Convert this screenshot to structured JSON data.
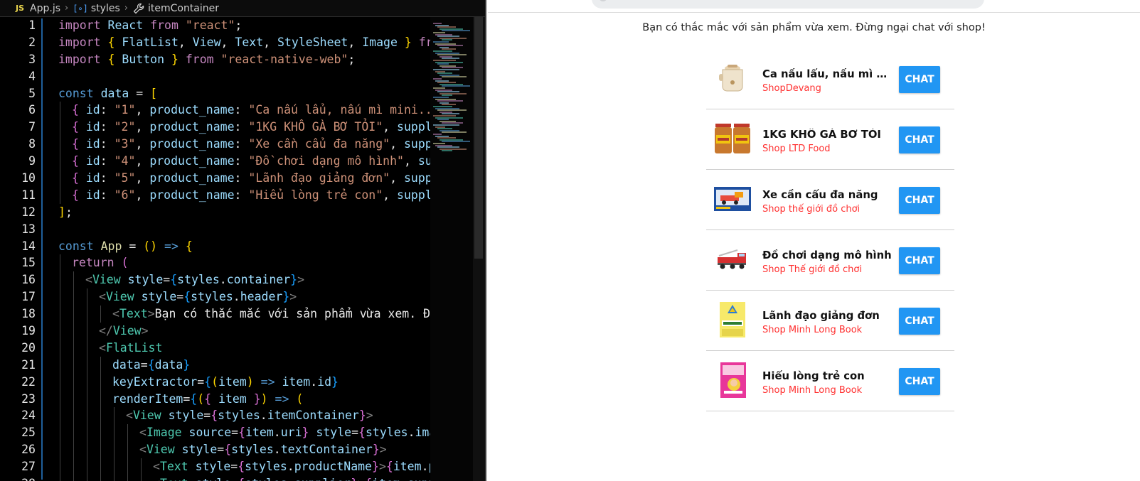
{
  "breadcrumb": {
    "badge": "JS",
    "file": "App.js",
    "crumb_2": "styles",
    "crumb_3": "itemContainer"
  },
  "editor": {
    "lines": [
      {
        "n": "1",
        "indent": 0,
        "tokens": [
          [
            "k-imp",
            "import"
          ],
          [
            "txt",
            " "
          ],
          [
            "ident",
            "React"
          ],
          [
            "txt",
            " "
          ],
          [
            "k-imp",
            "from"
          ],
          [
            "txt",
            " "
          ],
          [
            "str",
            "\"react\""
          ],
          [
            "txt",
            ";"
          ]
        ]
      },
      {
        "n": "2",
        "indent": 0,
        "tokens": [
          [
            "k-imp",
            "import"
          ],
          [
            "txt",
            " "
          ],
          [
            "brace",
            "{"
          ],
          [
            "txt",
            " "
          ],
          [
            "ident",
            "FlatList"
          ],
          [
            "txt",
            ", "
          ],
          [
            "ident",
            "View"
          ],
          [
            "txt",
            ", "
          ],
          [
            "ident",
            "Text"
          ],
          [
            "txt",
            ", "
          ],
          [
            "ident",
            "StyleSheet"
          ],
          [
            "txt",
            ", "
          ],
          [
            "ident",
            "Image"
          ],
          [
            "txt",
            " "
          ],
          [
            "brace",
            "}"
          ],
          [
            "txt",
            " "
          ],
          [
            "k-imp",
            "fro"
          ]
        ]
      },
      {
        "n": "3",
        "indent": 0,
        "tokens": [
          [
            "k-imp",
            "import"
          ],
          [
            "txt",
            " "
          ],
          [
            "brace",
            "{"
          ],
          [
            "txt",
            " "
          ],
          [
            "ident",
            "Button"
          ],
          [
            "txt",
            " "
          ],
          [
            "brace",
            "}"
          ],
          [
            "txt",
            " "
          ],
          [
            "k-imp",
            "from"
          ],
          [
            "txt",
            " "
          ],
          [
            "str",
            "\"react-native-web\""
          ],
          [
            "txt",
            ";"
          ]
        ]
      },
      {
        "n": "4",
        "indent": 0,
        "tokens": []
      },
      {
        "n": "5",
        "indent": 0,
        "tokens": [
          [
            "k-dec",
            "const"
          ],
          [
            "txt",
            " "
          ],
          [
            "ident",
            "data"
          ],
          [
            "txt",
            " = "
          ],
          [
            "brace",
            "["
          ]
        ]
      },
      {
        "n": "6",
        "indent": 1,
        "tokens": [
          [
            "brace2",
            "{"
          ],
          [
            "txt",
            " "
          ],
          [
            "ident",
            "id"
          ],
          [
            "txt",
            ": "
          ],
          [
            "str",
            "\"1\""
          ],
          [
            "txt",
            ", "
          ],
          [
            "ident",
            "product_name"
          ],
          [
            "txt",
            ": "
          ],
          [
            "str",
            "\"Ca nấu lẩu, nấu mì mini...\""
          ],
          [
            "txt",
            " "
          ]
        ]
      },
      {
        "n": "7",
        "indent": 1,
        "tokens": [
          [
            "brace2",
            "{"
          ],
          [
            "txt",
            " "
          ],
          [
            "ident",
            "id"
          ],
          [
            "txt",
            ": "
          ],
          [
            "str",
            "\"2\""
          ],
          [
            "txt",
            ", "
          ],
          [
            "ident",
            "product_name"
          ],
          [
            "txt",
            ": "
          ],
          [
            "str",
            "\"1KG KHÔ GÀ BƠ TỎI\""
          ],
          [
            "txt",
            ", "
          ],
          [
            "ident",
            "suppli"
          ]
        ]
      },
      {
        "n": "8",
        "indent": 1,
        "tokens": [
          [
            "brace2",
            "{"
          ],
          [
            "txt",
            " "
          ],
          [
            "ident",
            "id"
          ],
          [
            "txt",
            ": "
          ],
          [
            "str",
            "\"3\""
          ],
          [
            "txt",
            ", "
          ],
          [
            "ident",
            "product_name"
          ],
          [
            "txt",
            ": "
          ],
          [
            "str",
            "\"Xe cần cẩu đa năng\""
          ],
          [
            "txt",
            ", "
          ],
          [
            "ident",
            "suppl"
          ]
        ]
      },
      {
        "n": "9",
        "indent": 1,
        "tokens": [
          [
            "brace2",
            "{"
          ],
          [
            "txt",
            " "
          ],
          [
            "ident",
            "id"
          ],
          [
            "txt",
            ": "
          ],
          [
            "str",
            "\"4\""
          ],
          [
            "txt",
            ", "
          ],
          [
            "ident",
            "product_name"
          ],
          [
            "txt",
            ": "
          ],
          [
            "str",
            "\"Đồ chơi dạng mô hình\""
          ],
          [
            "txt",
            ", "
          ],
          [
            "ident",
            "sup"
          ]
        ]
      },
      {
        "n": "10",
        "indent": 1,
        "tokens": [
          [
            "brace2",
            "{"
          ],
          [
            "txt",
            " "
          ],
          [
            "ident",
            "id"
          ],
          [
            "txt",
            ": "
          ],
          [
            "str",
            "\"5\""
          ],
          [
            "txt",
            ", "
          ],
          [
            "ident",
            "product_name"
          ],
          [
            "txt",
            ": "
          ],
          [
            "str",
            "\"Lãnh đạo giảng đơn\""
          ],
          [
            "txt",
            ", "
          ],
          [
            "ident",
            "suppl"
          ]
        ]
      },
      {
        "n": "11",
        "indent": 1,
        "tokens": [
          [
            "brace2",
            "{"
          ],
          [
            "txt",
            " "
          ],
          [
            "ident",
            "id"
          ],
          [
            "txt",
            ": "
          ],
          [
            "str",
            "\"6\""
          ],
          [
            "txt",
            ", "
          ],
          [
            "ident",
            "product_name"
          ],
          [
            "txt",
            ": "
          ],
          [
            "str",
            "\"Hiểu lòng trẻ con\""
          ],
          [
            "txt",
            ", "
          ],
          [
            "ident",
            "suppli"
          ]
        ]
      },
      {
        "n": "12",
        "indent": 0,
        "tokens": [
          [
            "brace",
            "]"
          ],
          [
            "txt",
            ";"
          ]
        ]
      },
      {
        "n": "13",
        "indent": 0,
        "tokens": []
      },
      {
        "n": "14",
        "indent": 0,
        "tokens": [
          [
            "k-dec",
            "const"
          ],
          [
            "txt",
            " "
          ],
          [
            "fn",
            "App"
          ],
          [
            "txt",
            " = "
          ],
          [
            "brace",
            "()"
          ],
          [
            "txt",
            " "
          ],
          [
            "k-dec",
            "=>"
          ],
          [
            "txt",
            " "
          ],
          [
            "brace",
            "{"
          ]
        ]
      },
      {
        "n": "15",
        "indent": 1,
        "tokens": [
          [
            "k-imp",
            "return"
          ],
          [
            "txt",
            " "
          ],
          [
            "brace2",
            "("
          ]
        ]
      },
      {
        "n": "16",
        "indent": 2,
        "tokens": [
          [
            "punct",
            "<"
          ],
          [
            "tag",
            "View"
          ],
          [
            "txt",
            " "
          ],
          [
            "ident",
            "style"
          ],
          [
            "txt",
            "="
          ],
          [
            "brace3",
            "{"
          ],
          [
            "ident",
            "styles"
          ],
          [
            "txt",
            "."
          ],
          [
            "ident",
            "container"
          ],
          [
            "brace3",
            "}"
          ],
          [
            "punct",
            ">"
          ]
        ]
      },
      {
        "n": "17",
        "indent": 3,
        "tokens": [
          [
            "punct",
            "<"
          ],
          [
            "tag",
            "View"
          ],
          [
            "txt",
            " "
          ],
          [
            "ident",
            "style"
          ],
          [
            "txt",
            "="
          ],
          [
            "brace3",
            "{"
          ],
          [
            "ident",
            "styles"
          ],
          [
            "txt",
            "."
          ],
          [
            "ident",
            "header"
          ],
          [
            "brace3",
            "}"
          ],
          [
            "punct",
            ">"
          ]
        ]
      },
      {
        "n": "18",
        "indent": 4,
        "tokens": [
          [
            "punct",
            "<"
          ],
          [
            "tag",
            "Text"
          ],
          [
            "punct",
            ">"
          ],
          [
            "txt",
            "Bạn có thắc mắc với sản phẩm vừa xem. Đừ"
          ]
        ]
      },
      {
        "n": "19",
        "indent": 3,
        "tokens": [
          [
            "punct",
            "</"
          ],
          [
            "tag",
            "View"
          ],
          [
            "punct",
            ">"
          ]
        ]
      },
      {
        "n": "20",
        "indent": 3,
        "tokens": [
          [
            "punct",
            "<"
          ],
          [
            "tag",
            "FlatList"
          ]
        ]
      },
      {
        "n": "21",
        "indent": 4,
        "tokens": [
          [
            "ident",
            "data"
          ],
          [
            "txt",
            "="
          ],
          [
            "brace3",
            "{"
          ],
          [
            "ident",
            "data"
          ],
          [
            "brace3",
            "}"
          ]
        ]
      },
      {
        "n": "22",
        "indent": 4,
        "tokens": [
          [
            "ident",
            "keyExtractor"
          ],
          [
            "txt",
            "="
          ],
          [
            "brace3",
            "{"
          ],
          [
            "brace",
            "("
          ],
          [
            "ident",
            "item"
          ],
          [
            "brace",
            ")"
          ],
          [
            "txt",
            " "
          ],
          [
            "k-dec",
            "=>"
          ],
          [
            "txt",
            " "
          ],
          [
            "ident",
            "item"
          ],
          [
            "txt",
            "."
          ],
          [
            "ident",
            "id"
          ],
          [
            "brace3",
            "}"
          ]
        ]
      },
      {
        "n": "23",
        "indent": 4,
        "tokens": [
          [
            "ident",
            "renderItem"
          ],
          [
            "txt",
            "="
          ],
          [
            "brace3",
            "{"
          ],
          [
            "brace",
            "("
          ],
          [
            "brace2",
            "{"
          ],
          [
            "txt",
            " "
          ],
          [
            "ident",
            "item"
          ],
          [
            "txt",
            " "
          ],
          [
            "brace2",
            "}"
          ],
          [
            "brace",
            ")"
          ],
          [
            "txt",
            " "
          ],
          [
            "k-dec",
            "=>"
          ],
          [
            "txt",
            " "
          ],
          [
            "brace",
            "("
          ]
        ]
      },
      {
        "n": "24",
        "indent": 5,
        "tokens": [
          [
            "punct",
            "<"
          ],
          [
            "tag",
            "View"
          ],
          [
            "txt",
            " "
          ],
          [
            "ident",
            "style"
          ],
          [
            "txt",
            "="
          ],
          [
            "brace2",
            "{"
          ],
          [
            "ident",
            "styles"
          ],
          [
            "txt",
            "."
          ],
          [
            "ident",
            "itemContainer"
          ],
          [
            "brace2",
            "}"
          ],
          [
            "punct",
            ">"
          ]
        ]
      },
      {
        "n": "25",
        "indent": 6,
        "tokens": [
          [
            "punct",
            "<"
          ],
          [
            "tag",
            "Image"
          ],
          [
            "txt",
            " "
          ],
          [
            "ident",
            "source"
          ],
          [
            "txt",
            "="
          ],
          [
            "brace2",
            "{"
          ],
          [
            "ident",
            "item"
          ],
          [
            "txt",
            "."
          ],
          [
            "ident",
            "uri"
          ],
          [
            "brace2",
            "}"
          ],
          [
            "txt",
            " "
          ],
          [
            "ident",
            "style"
          ],
          [
            "txt",
            "="
          ],
          [
            "brace2",
            "{"
          ],
          [
            "ident",
            "styles"
          ],
          [
            "txt",
            "."
          ],
          [
            "ident",
            "ima"
          ]
        ]
      },
      {
        "n": "26",
        "indent": 6,
        "tokens": [
          [
            "punct",
            "<"
          ],
          [
            "tag",
            "View"
          ],
          [
            "txt",
            " "
          ],
          [
            "ident",
            "style"
          ],
          [
            "txt",
            "="
          ],
          [
            "brace2",
            "{"
          ],
          [
            "ident",
            "styles"
          ],
          [
            "txt",
            "."
          ],
          [
            "ident",
            "textContainer"
          ],
          [
            "brace2",
            "}"
          ],
          [
            "punct",
            ">"
          ]
        ]
      },
      {
        "n": "27",
        "indent": 7,
        "tokens": [
          [
            "punct",
            "<"
          ],
          [
            "tag",
            "Text"
          ],
          [
            "txt",
            " "
          ],
          [
            "ident",
            "style"
          ],
          [
            "txt",
            "="
          ],
          [
            "brace2",
            "{"
          ],
          [
            "ident",
            "styles"
          ],
          [
            "txt",
            "."
          ],
          [
            "ident",
            "productName"
          ],
          [
            "brace2",
            "}"
          ],
          [
            "punct",
            ">"
          ],
          [
            "brace2",
            "{"
          ],
          [
            "ident",
            "item"
          ],
          [
            "txt",
            "."
          ],
          [
            "ident",
            "p"
          ]
        ]
      },
      {
        "n": "28",
        "indent": 7,
        "tokens": [
          [
            "punct",
            "<"
          ],
          [
            "tag",
            "Text"
          ],
          [
            "txt",
            " "
          ],
          [
            "ident",
            "style"
          ],
          [
            "txt",
            "="
          ],
          [
            "brace2",
            "{"
          ],
          [
            "ident",
            "styles"
          ],
          [
            "txt",
            "."
          ],
          [
            "ident",
            "supplier"
          ],
          [
            "brace2",
            "}"
          ],
          [
            "punct",
            ">"
          ],
          [
            "brace2",
            "{"
          ],
          [
            "ident",
            "item"
          ],
          [
            "txt",
            "."
          ],
          [
            "ident",
            "supp"
          ]
        ]
      }
    ]
  },
  "preview": {
    "header": "Bạn có thắc mắc với sản phẩm vừa xem. Đừng ngại chat với shop!",
    "chat_label": "CHAT",
    "products": [
      {
        "name": "Ca nấu lẩu, nấu mì mini...",
        "supplier": "ShopDevang",
        "icon": "cooker-image"
      },
      {
        "name": "1KG KHÔ GÀ BƠ TỎI",
        "supplier": "Shop LTD Food",
        "icon": "jars-image"
      },
      {
        "name": "Xe cần cẩu đa năng",
        "supplier": "Shop thế giới đồ chơi",
        "icon": "toy-box-image"
      },
      {
        "name": "Đồ chơi dạng mô hình",
        "supplier": "Shop Thế giới đồ chơi",
        "icon": "fire-truck-image"
      },
      {
        "name": "Lãnh đạo giảng đơn",
        "supplier": "Shop Minh Long Book",
        "icon": "book-cover-image"
      },
      {
        "name": "Hiểu lòng trẻ con",
        "supplier": "Shop Minh Long Book",
        "icon": "pink-book-image"
      }
    ]
  },
  "colors": {
    "chat_button": "#2196f3",
    "supplier_text": "#ff3030"
  }
}
